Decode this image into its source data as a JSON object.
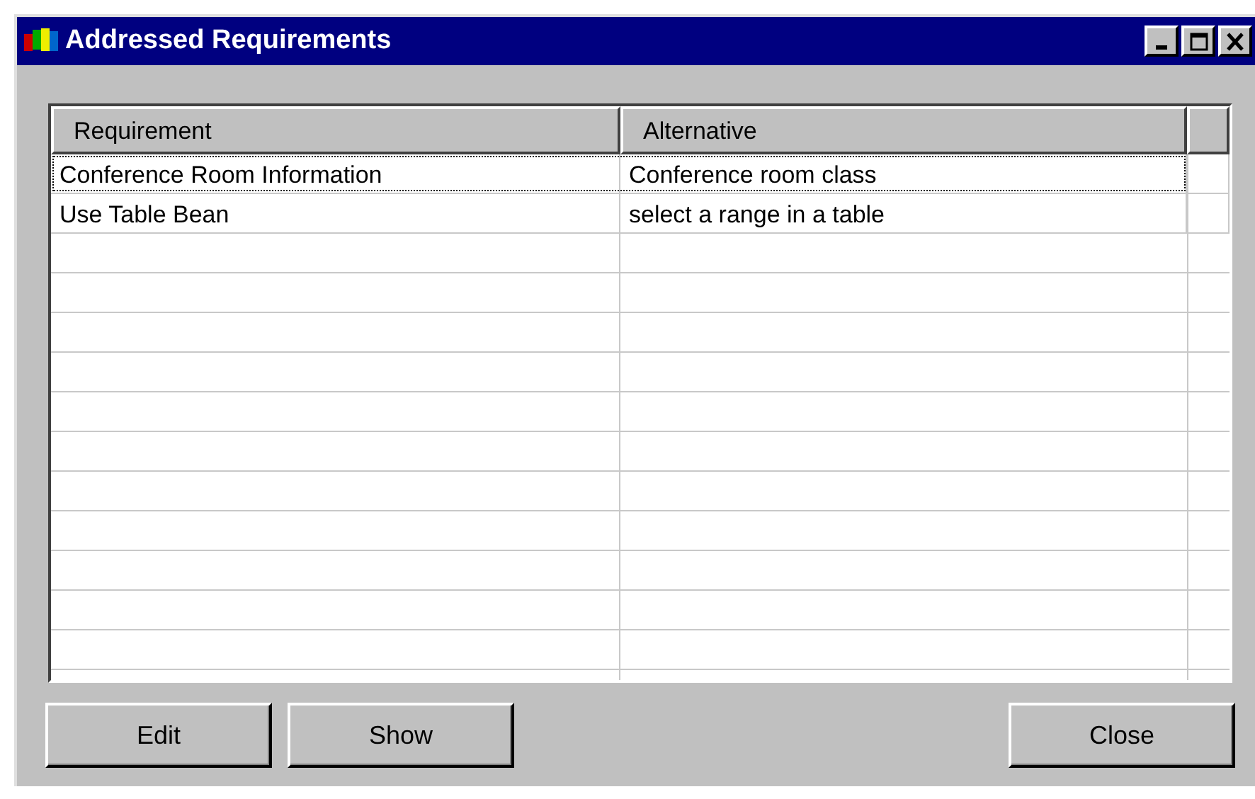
{
  "window": {
    "title": "Addressed Requirements"
  },
  "table": {
    "columns": [
      "Requirement",
      "Alternative"
    ],
    "rows": [
      {
        "cells": [
          "Conference Room Information",
          "Conference room class"
        ],
        "focused": true
      },
      {
        "cells": [
          "Use Table Bean",
          "select a range in a table"
        ],
        "focused": false
      }
    ]
  },
  "buttons": [
    "Edit",
    "Show",
    "Close"
  ]
}
